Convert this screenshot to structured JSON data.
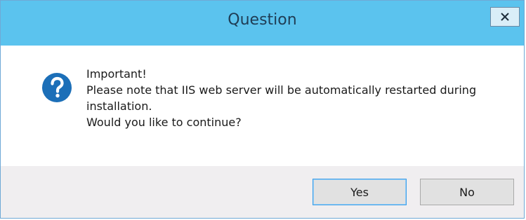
{
  "window": {
    "title": "Question",
    "close_icon": "close-icon",
    "colors": {
      "titlebar": "#5bc3ee",
      "content_bg": "#ffffff",
      "footer_bg": "#f0eef0",
      "icon_blue": "#1c6fb8"
    }
  },
  "message": {
    "icon": "question-icon",
    "lines": [
      "Important!",
      "Please note that IIS web server will be automatically restarted during",
      "installation.",
      "Would you like to continue?"
    ]
  },
  "buttons": {
    "yes_label": "Yes",
    "no_label": "No"
  }
}
